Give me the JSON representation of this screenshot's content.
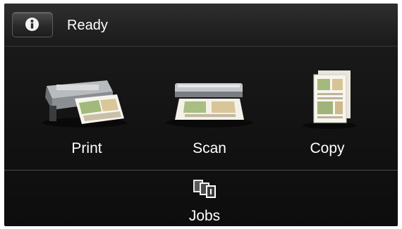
{
  "status": {
    "info_icon": "info-icon",
    "text": "Ready"
  },
  "tiles": [
    {
      "label": "Print",
      "icon": "printer-icon"
    },
    {
      "label": "Scan",
      "icon": "scanner-icon"
    },
    {
      "label": "Copy",
      "icon": "copy-document-icon"
    }
  ],
  "jobs": {
    "label": "Jobs",
    "icon": "jobs-queue-icon"
  },
  "colors": {
    "background": "#121212",
    "text": "#ffffff",
    "divider": "#4a4a4a"
  }
}
